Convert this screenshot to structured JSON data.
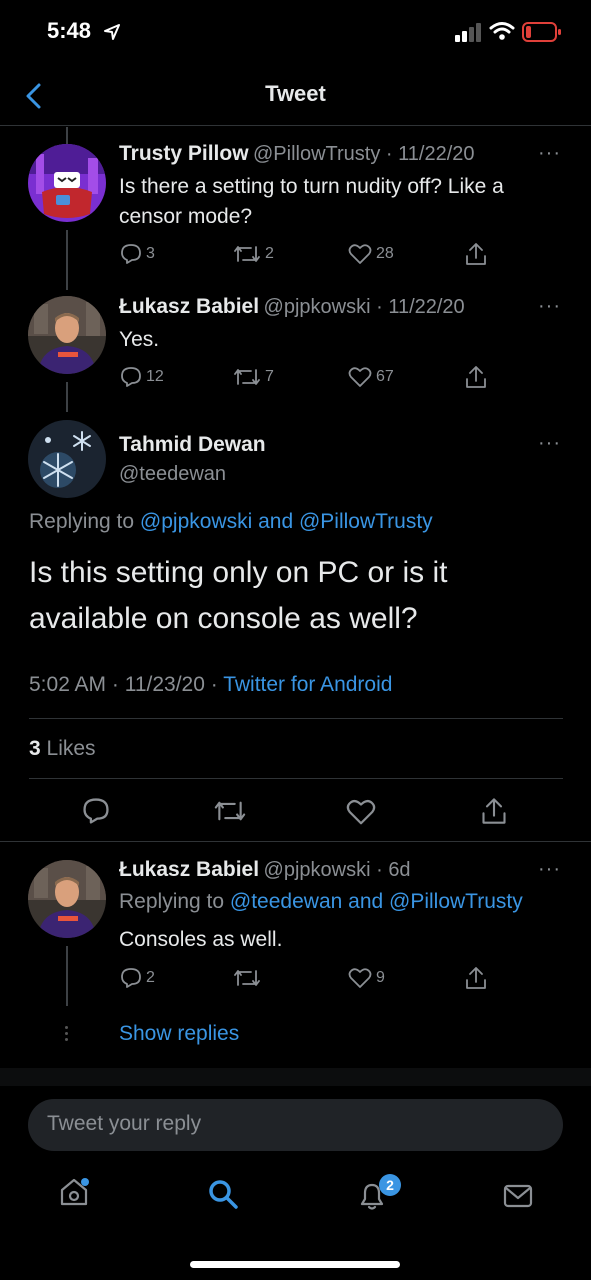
{
  "status_bar": {
    "time": "5:48"
  },
  "nav": {
    "title": "Tweet"
  },
  "tweets": [
    {
      "name": "Trusty Pillow",
      "handle": "@PillowTrusty",
      "date": "11/22/20",
      "text_line1": "Is there a setting to turn nudity off? Like a",
      "text_line2": "censor mode?",
      "replies": "3",
      "retweets": "2",
      "likes": "28"
    },
    {
      "name": "Łukasz Babiel",
      "handle": "@pjpkowski",
      "date": "11/22/20",
      "text_line1": "Yes.",
      "replies": "12",
      "retweets": "7",
      "likes": "67"
    }
  ],
  "main_tweet": {
    "name": "Tahmid Dewan",
    "handle": "@teedewan",
    "replying_prefix": "Replying to",
    "replying_to": "@pjpkowski and @PillowTrusty",
    "text_line1": "Is this setting only on PC or is it",
    "text_line2": "available on console as well?",
    "timestamp": "5:02 AM · 11/23/20 ·",
    "source": "Twitter for Android",
    "likes_count": "3",
    "likes_label": "Likes"
  },
  "reply": {
    "name": "Łukasz Babiel",
    "handle": "@pjpkowski",
    "age": "6d",
    "replying_prefix": "Replying to",
    "replying_to": "@teedewan and @PillowTrusty",
    "text": "Consoles as well.",
    "replies": "2",
    "likes": "9",
    "show_replies": "Show replies"
  },
  "composer": {
    "placeholder": "Tweet your reply"
  },
  "tabbar": {
    "notifications_badge": "2"
  },
  "colors": {
    "accent": "#3a95e3",
    "background": "#000000",
    "muted": "#8b8f94",
    "battery": "#e0403a"
  }
}
